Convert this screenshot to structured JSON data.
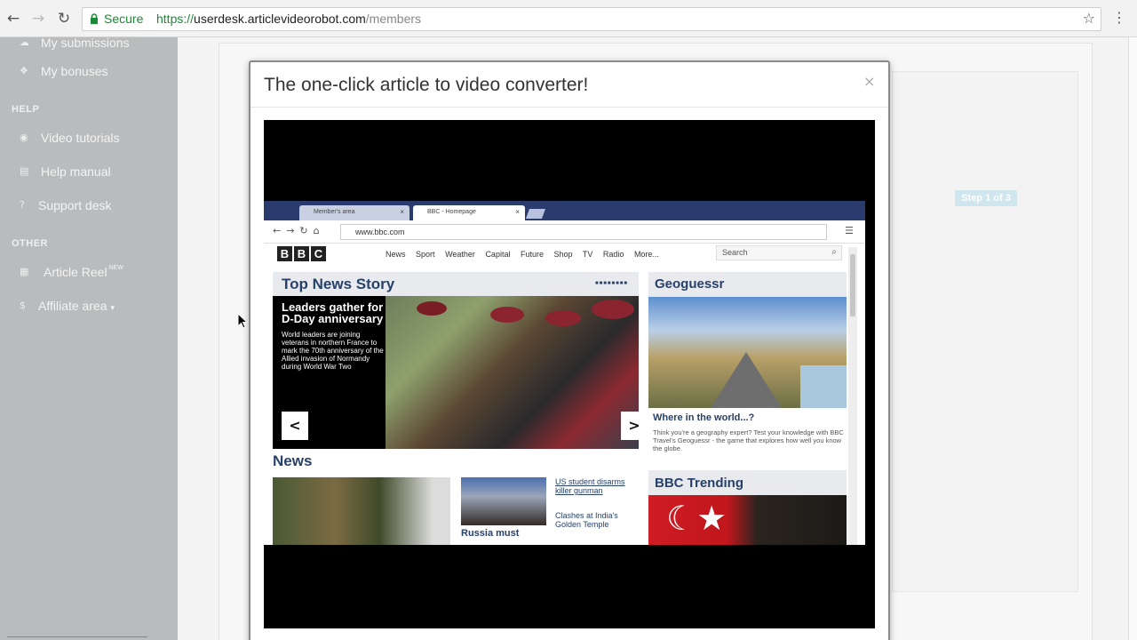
{
  "browser": {
    "secure_label": "Secure",
    "url_scheme": "https://",
    "url_host": "userdesk.articlevideorobot.com",
    "url_path": "/members"
  },
  "sidebar": {
    "items_top": [
      {
        "label": "My submissions",
        "icon": "cloud-upload-icon"
      },
      {
        "label": "My bonuses",
        "icon": "gift-icon"
      }
    ],
    "help_heading": "HELP",
    "help_items": [
      {
        "label": "Video tutorials",
        "icon": "play-circle-icon"
      },
      {
        "label": "Help manual",
        "icon": "book-icon"
      },
      {
        "label": "Support desk",
        "icon": "question-icon"
      }
    ],
    "other_heading": "OTHER",
    "other_items": [
      {
        "label": "Article Reel",
        "badge": "NEW",
        "icon": "film-icon"
      },
      {
        "label": "Affiliate area",
        "icon": "dollar-icon"
      }
    ]
  },
  "background": {
    "step_badge": "Step 1 of 3"
  },
  "modal": {
    "title": "The one-click article to video converter!",
    "close_label": "×"
  },
  "video": {
    "tabs": [
      {
        "label": "Member's area"
      },
      {
        "label": "BBC - Homepage"
      }
    ],
    "address": "www.bbc.com",
    "bbc_logo": [
      "B",
      "B",
      "C"
    ],
    "bbc_menu": [
      "News",
      "Sport",
      "Weather",
      "Capital",
      "Future",
      "Shop",
      "TV",
      "Radio",
      "More..."
    ],
    "search_placeholder": "Search",
    "top_news_heading": "Top News Story",
    "top_news_headline": "Leaders gather for D-Day anniversary",
    "top_news_body": "World leaders are joining veterans in northern France to mark the 70th anniversary of the Allied invasion of Normandy during World War Two",
    "news_heading": "News",
    "news_sub": "Russia must",
    "news_link1": "US student disarms killer gunman",
    "news_link2": "Clashes at India's Golden Temple",
    "geo_heading": "Geoguessr",
    "geo_sub": "Where in the world...?",
    "geo_body": "Think you're a geography expert? Test your knowledge with BBC Travel's Geoguessr - the game that explores how well you know the globe.",
    "trending_heading": "BBC Trending"
  },
  "colors": {
    "secure_green": "#1a8a34",
    "sidebar_bg": "#b9bbbd",
    "bbc_blue": "#27416a"
  }
}
